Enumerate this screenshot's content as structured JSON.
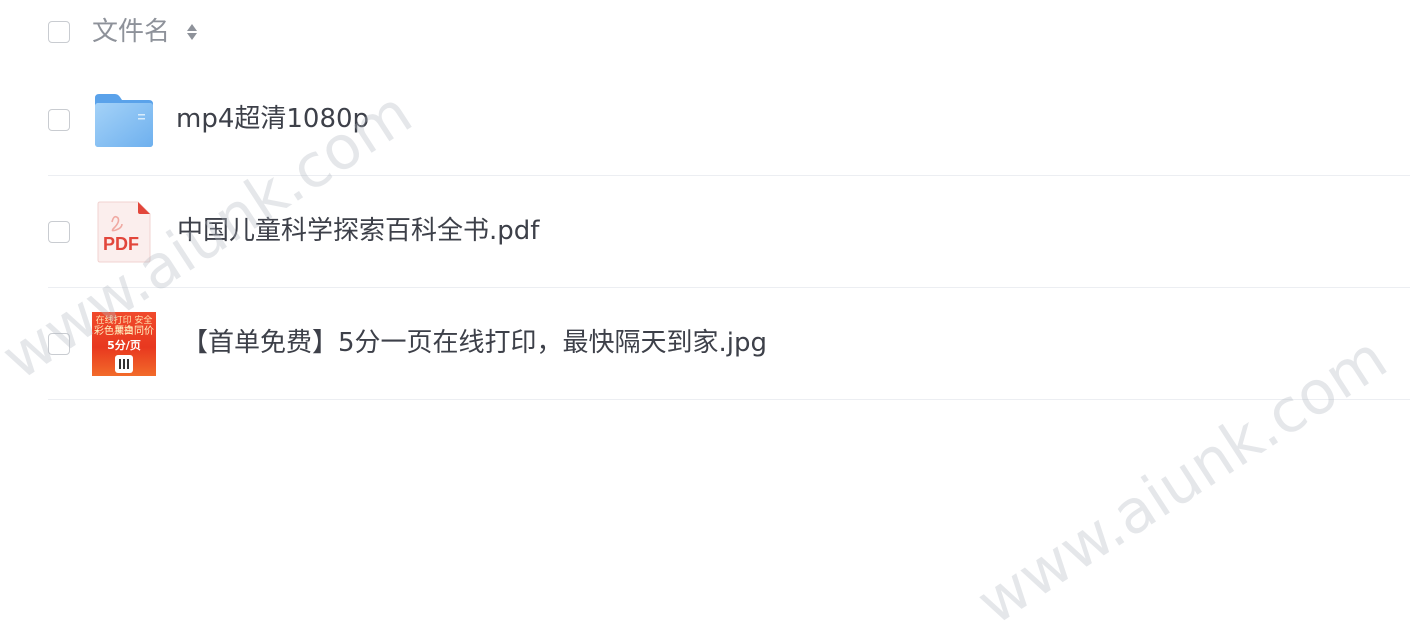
{
  "header": {
    "column_label": "文件名",
    "sort_icon": "sort-icon"
  },
  "files": [
    {
      "name": "mp4超清1080p",
      "type": "folder",
      "icon": "folder-icon"
    },
    {
      "name": "中国儿童科学探索百科全书.pdf",
      "type": "pdf",
      "icon": "pdf-file-icon",
      "icon_label": "PDF"
    },
    {
      "name": "【首单免费】5分一页在线打印，最快隔天到家.jpg",
      "type": "image",
      "icon": "image-thumbnail",
      "thumbnail_text": [
        "在线打印 安全便捷",
        "彩色黑白同价",
        "5分/页"
      ]
    }
  ],
  "watermark": "www.aiunk.com",
  "colors": {
    "folder": "#7cb8ef",
    "pdf_accent": "#e2463b",
    "text_primary": "#3d4049",
    "text_header": "#8e929a",
    "divider": "#eceef2"
  }
}
